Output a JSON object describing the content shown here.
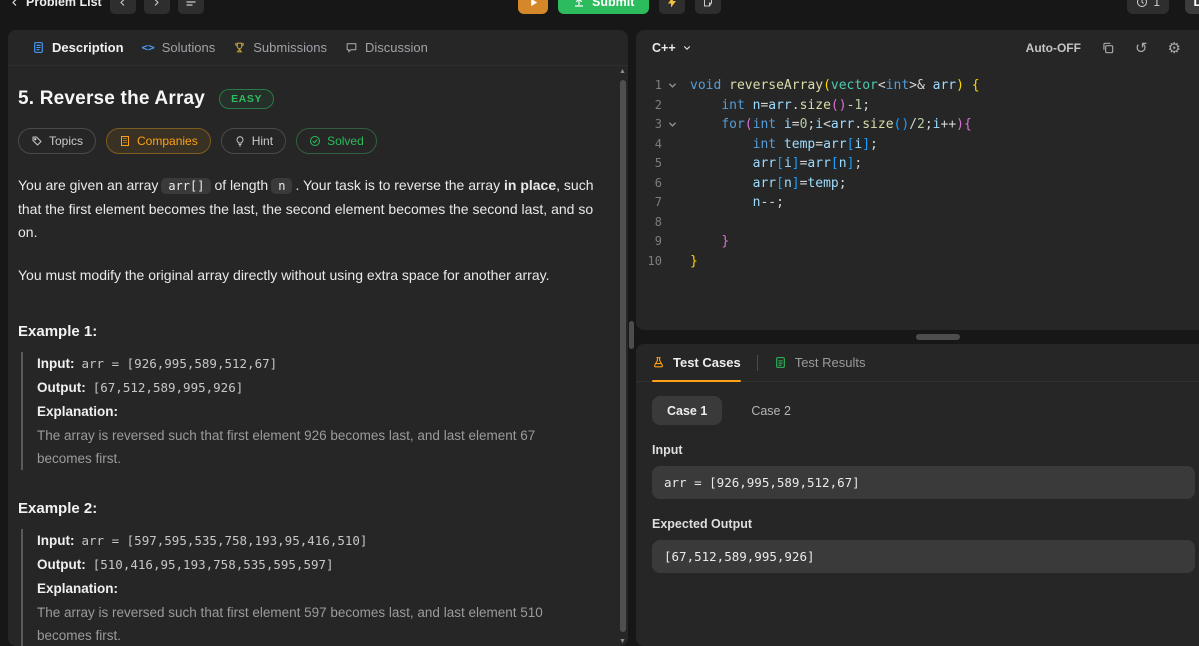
{
  "colors": {
    "accent_orange": "#ffa116",
    "success_green": "#2cbb5d",
    "keyword_blue": "#569cd6",
    "panel_bg": "#262626",
    "page_bg": "#171717"
  },
  "topbar": {
    "problem_list_label": "Problem List",
    "submit_label": "Submit",
    "streak_count": "1",
    "avatar_letter": "D"
  },
  "description_tabs": {
    "description": "Description",
    "solutions": "Solutions",
    "submissions": "Submissions",
    "discussion": "Discussion"
  },
  "problem": {
    "title": "5. Reverse the Array",
    "difficulty": "EASY",
    "actions": {
      "topics": "Topics",
      "companies": "Companies",
      "hint": "Hint",
      "solved": "Solved"
    },
    "statement": {
      "p1_text1": "You are given an array",
      "p1_code1": "arr[]",
      "p1_text2": "of length",
      "p1_code2": "n",
      "p1_text3": ". Your task is to reverse the array",
      "p1_bold": "in place",
      "p1_text4": ", such that the first element becomes the last, the second element becomes the second last, and so on.",
      "p2": "You must modify the original array directly without using extra space for another array."
    },
    "examples": [
      {
        "heading": "Example 1:",
        "input_label": "Input:",
        "input_value": "arr = [926,995,589,512,67]",
        "output_label": "Output:",
        "output_value": "[67,512,589,995,926]",
        "explanation_label": "Explanation:",
        "explanation_text": "The array is reversed such that first element 926 becomes last, and last element 67 becomes first."
      },
      {
        "heading": "Example 2:",
        "input_label": "Input:",
        "input_value": "arr = [597,595,535,758,193,95,416,510]",
        "output_label": "Output:",
        "output_value": "[510,416,95,193,758,535,595,597]",
        "explanation_label": "Explanation:",
        "explanation_text": "The array is reversed such that first element 597 becomes last, and last element 510 becomes first."
      }
    ]
  },
  "editor": {
    "language": "C++",
    "auto_label": "Auto-OFF",
    "lines": [
      {
        "num": 1,
        "fold": true,
        "tokens": [
          [
            "void",
            "kw"
          ],
          [
            " ",
            "pl"
          ],
          [
            "reverseArray",
            "fn"
          ],
          [
            "(",
            "b1"
          ],
          [
            "vector",
            "type"
          ],
          [
            "<",
            "op"
          ],
          [
            "int",
            "kw"
          ],
          [
            ">&",
            "op"
          ],
          [
            " arr",
            "var"
          ],
          [
            ")",
            "b1"
          ],
          [
            " {",
            "b1"
          ]
        ]
      },
      {
        "num": 2,
        "tokens": [
          [
            "    ",
            "pl"
          ],
          [
            "int",
            "kw"
          ],
          [
            " n",
            "var"
          ],
          [
            "=",
            "op"
          ],
          [
            "arr",
            "var"
          ],
          [
            ".",
            "op"
          ],
          [
            "size",
            "fn"
          ],
          [
            "()",
            "b2"
          ],
          [
            "-",
            "op"
          ],
          [
            "1",
            "num"
          ],
          [
            ";",
            "op"
          ]
        ]
      },
      {
        "num": 3,
        "fold": true,
        "tokens": [
          [
            "    ",
            "pl"
          ],
          [
            "for",
            "kw"
          ],
          [
            "(",
            "b2"
          ],
          [
            "int",
            "kw"
          ],
          [
            " i",
            "var"
          ],
          [
            "=",
            "op"
          ],
          [
            "0",
            "num"
          ],
          [
            ";",
            "op"
          ],
          [
            "i",
            "var"
          ],
          [
            "<",
            "op"
          ],
          [
            "arr",
            "var"
          ],
          [
            ".",
            "op"
          ],
          [
            "size",
            "fn"
          ],
          [
            "()",
            "b3"
          ],
          [
            "/",
            "op"
          ],
          [
            "2",
            "num"
          ],
          [
            ";",
            "op"
          ],
          [
            "i",
            "var"
          ],
          [
            "++",
            "op"
          ],
          [
            "){",
            "b2"
          ]
        ]
      },
      {
        "num": 4,
        "tokens": [
          [
            "        ",
            "pl"
          ],
          [
            "int",
            "kw"
          ],
          [
            " temp",
            "var"
          ],
          [
            "=",
            "op"
          ],
          [
            "arr",
            "var"
          ],
          [
            "[",
            "b3"
          ],
          [
            "i",
            "var"
          ],
          [
            "]",
            "b3"
          ],
          [
            ";",
            "op"
          ]
        ]
      },
      {
        "num": 5,
        "tokens": [
          [
            "        ",
            "pl"
          ],
          [
            "arr",
            "var"
          ],
          [
            "[",
            "b3"
          ],
          [
            "i",
            "var"
          ],
          [
            "]",
            "b3"
          ],
          [
            "=",
            "op"
          ],
          [
            "arr",
            "var"
          ],
          [
            "[",
            "b3"
          ],
          [
            "n",
            "var"
          ],
          [
            "]",
            "b3"
          ],
          [
            ";",
            "op"
          ]
        ]
      },
      {
        "num": 6,
        "tokens": [
          [
            "        ",
            "pl"
          ],
          [
            "arr",
            "var"
          ],
          [
            "[",
            "b3"
          ],
          [
            "n",
            "var"
          ],
          [
            "]",
            "b3"
          ],
          [
            "=",
            "op"
          ],
          [
            "temp",
            "var"
          ],
          [
            ";",
            "op"
          ]
        ]
      },
      {
        "num": 7,
        "tokens": [
          [
            "        ",
            "pl"
          ],
          [
            "n",
            "var"
          ],
          [
            "--",
            "op"
          ],
          [
            ";",
            "op"
          ]
        ]
      },
      {
        "num": 8,
        "tokens": []
      },
      {
        "num": 9,
        "tokens": [
          [
            "    ",
            "pl"
          ],
          [
            "}",
            "b2"
          ]
        ]
      },
      {
        "num": 10,
        "tokens": [
          [
            "}",
            "b1"
          ]
        ]
      }
    ]
  },
  "tests": {
    "tab_cases": "Test Cases",
    "tab_results": "Test Results",
    "case1": "Case 1",
    "case2": "Case 2",
    "input_label": "Input",
    "input_value": "arr = [926,995,589,512,67]",
    "expected_label": "Expected Output",
    "expected_value": "[67,512,589,995,926]"
  }
}
